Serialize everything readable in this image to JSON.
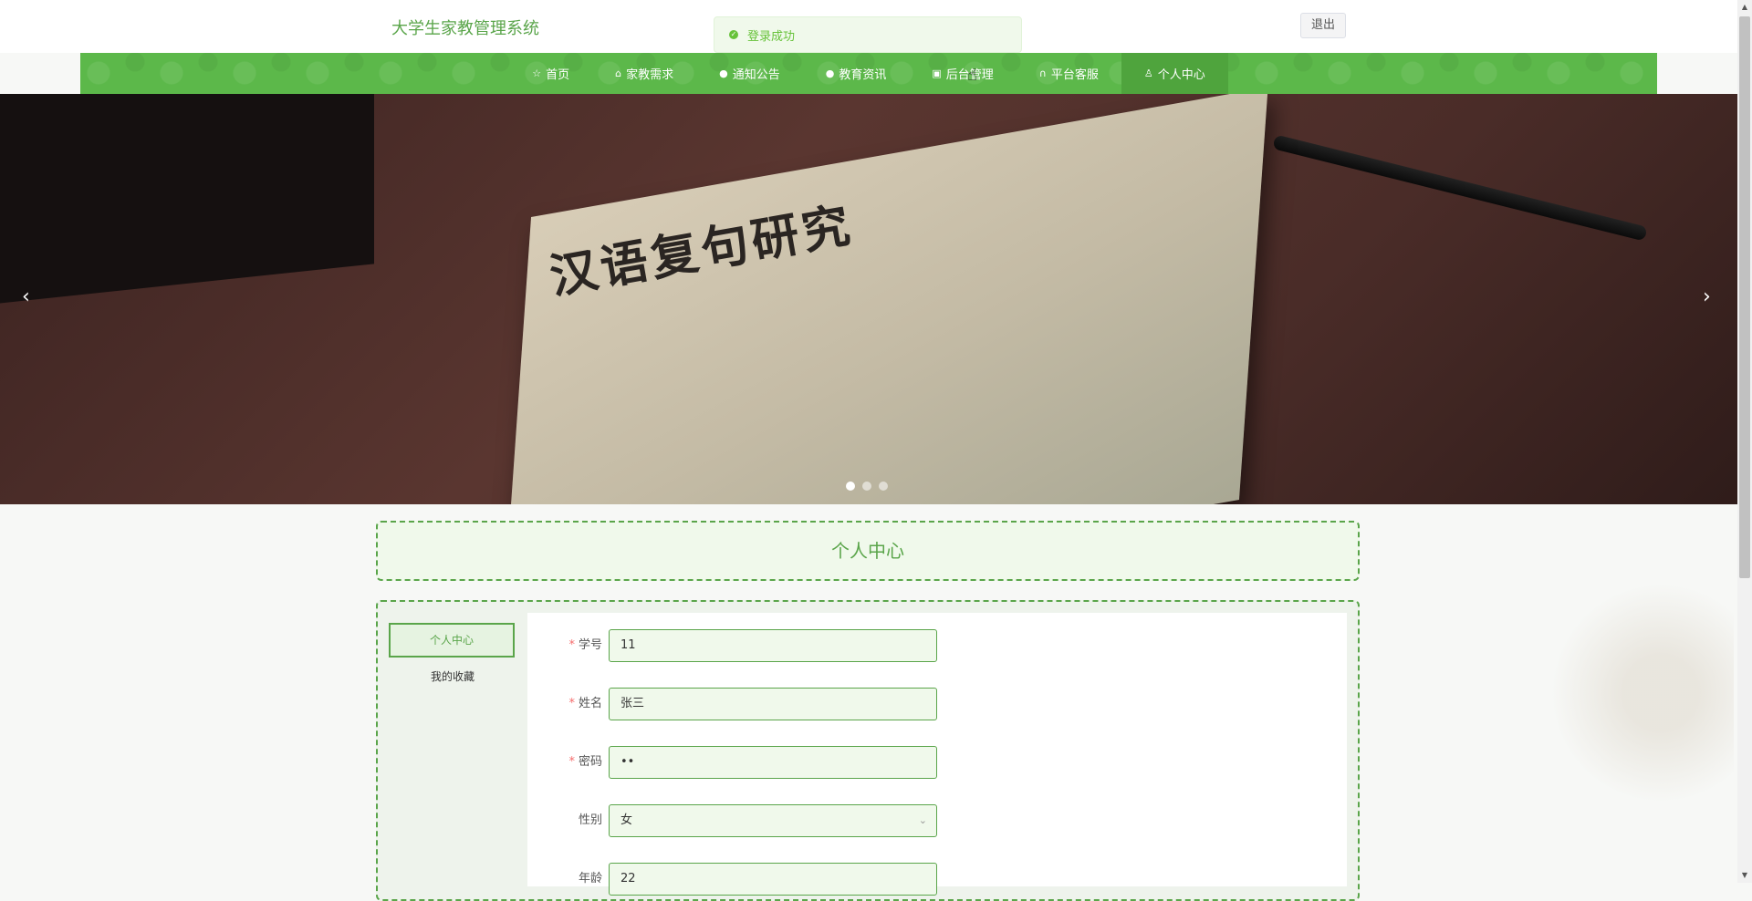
{
  "header": {
    "site_title": "大学生家教管理系统",
    "logout_label": "退出"
  },
  "toast": {
    "message": "登录成功"
  },
  "nav": {
    "items": [
      {
        "icon": "star-icon",
        "glyph": "☆",
        "label": "首页"
      },
      {
        "icon": "bag-icon",
        "glyph": "⌂",
        "label": "家教需求"
      },
      {
        "icon": "info-icon",
        "glyph": "●",
        "label": "通知公告"
      },
      {
        "icon": "question-icon",
        "glyph": "●",
        "label": "教育资讯"
      },
      {
        "icon": "box-icon",
        "glyph": "▣",
        "label": "后台管理"
      },
      {
        "icon": "headset-icon",
        "glyph": "∩",
        "label": "平台客服"
      },
      {
        "icon": "user-icon",
        "glyph": "♙",
        "label": "个人中心"
      }
    ],
    "active_index": 6
  },
  "banner": {
    "book_title": "汉语复句研究",
    "slides": 3,
    "active_slide": 0
  },
  "page": {
    "title": "个人中心"
  },
  "sidebar": {
    "items": [
      {
        "label": "个人中心"
      },
      {
        "label": "我的收藏"
      }
    ]
  },
  "form": {
    "fields": [
      {
        "label": "学号",
        "required": true,
        "value": "11"
      },
      {
        "label": "姓名",
        "required": true,
        "value": "张三"
      },
      {
        "label": "密码",
        "required": true,
        "value": "••"
      },
      {
        "label": "性别",
        "required": false,
        "value": "女"
      },
      {
        "label": "年龄",
        "required": false,
        "value": "22"
      }
    ]
  },
  "colors": {
    "accent": "#5aa54a",
    "nav_bg": "#5cb84a",
    "toast_text": "#67c23a"
  }
}
